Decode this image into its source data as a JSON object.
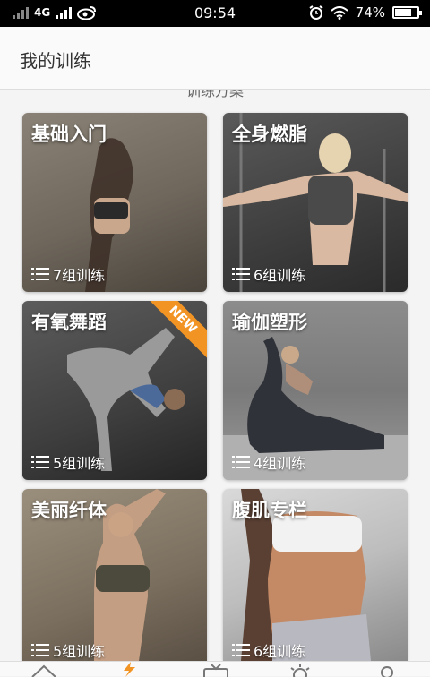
{
  "status_bar": {
    "network": "4G",
    "time": "09:54",
    "battery": "74%",
    "battery_level": 0.74
  },
  "header": {
    "title": "我的训练"
  },
  "section": {
    "title": "训练方案"
  },
  "cards": [
    {
      "title": "基础入门",
      "count": "7组训练"
    },
    {
      "title": "全身燃脂",
      "count": "6组训练"
    },
    {
      "title": "有氧舞蹈",
      "count": "5组训练",
      "badge": "NEW"
    },
    {
      "title": "瑜伽塑形",
      "count": "4组训练"
    },
    {
      "title": "美丽纤体",
      "count": "5组训练"
    },
    {
      "title": "腹肌专栏",
      "count": "6组训练"
    }
  ],
  "tabs": [
    {
      "icon": "home-icon"
    },
    {
      "icon": "lightning-icon"
    },
    {
      "icon": "tv-icon"
    },
    {
      "icon": "bulb-icon"
    },
    {
      "icon": "profile-icon"
    }
  ],
  "colors": {
    "accent": "#f29423",
    "status_bar": "#000000"
  }
}
